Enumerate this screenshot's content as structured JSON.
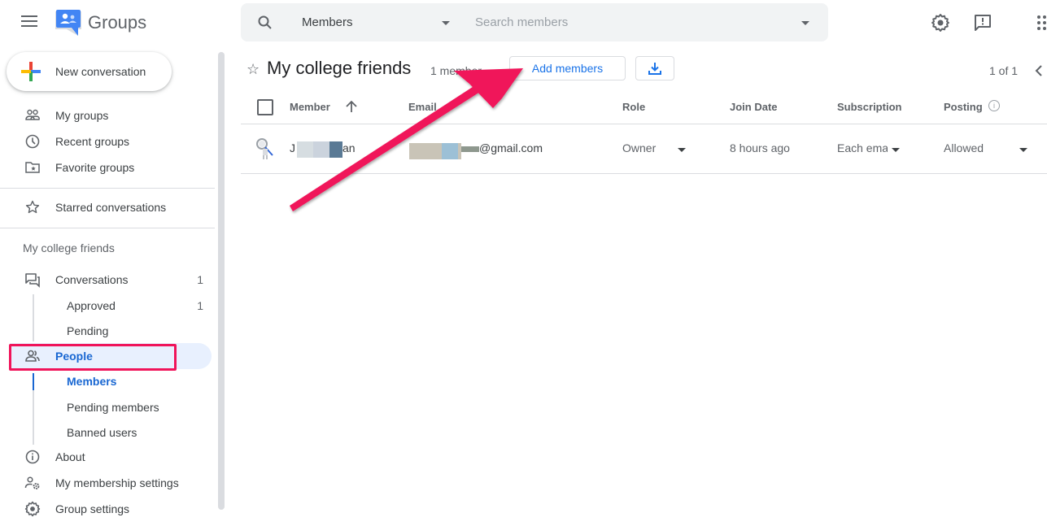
{
  "header": {
    "app_title": "Groups",
    "search": {
      "scope_selected": "Members",
      "placeholder": "Search members",
      "value": ""
    },
    "icons": [
      "settings-icon",
      "feedback-icon",
      "apps-grid-icon"
    ]
  },
  "sidebar": {
    "new_conversation_label": "New conversation",
    "top_items": [
      {
        "label": "My groups",
        "icon": "my-groups-icon"
      },
      {
        "label": "Recent groups",
        "icon": "clock-icon"
      },
      {
        "label": "Favorite groups",
        "icon": "star-folder-icon"
      }
    ],
    "starred_label": "Starred conversations",
    "group_heading": "My college friends",
    "group_items": {
      "conversations": {
        "label": "Conversations",
        "count": "1"
      },
      "approved": {
        "label": "Approved",
        "count": "1"
      },
      "pending": {
        "label": "Pending"
      },
      "people": {
        "label": "People"
      },
      "members": {
        "label": "Members"
      },
      "pending_members": {
        "label": "Pending members"
      },
      "banned_users": {
        "label": "Banned users"
      },
      "about": {
        "label": "About"
      },
      "membership_settings": {
        "label": "My membership settings"
      },
      "group_settings": {
        "label": "Group settings"
      }
    }
  },
  "main": {
    "group_title": "My college friends",
    "member_count": "1 member",
    "add_members_label": "Add members",
    "pagination": "1 of 1",
    "columns": [
      "Member",
      "Email",
      "Role",
      "Join Date",
      "Subscription",
      "Posting"
    ],
    "rows": [
      {
        "member_visible": "J",
        "member_suffix": "an",
        "email_suffix": "@gmail.com",
        "role": "Owner",
        "join_date": "8 hours ago",
        "subscription": "Each ema",
        "posting": "Allowed"
      }
    ]
  },
  "colors": {
    "accent_blue": "#1a73e8",
    "active_bg": "#e8f0fe",
    "annotation_pink": "#f0145a",
    "search_bg": "#f1f3f4"
  }
}
